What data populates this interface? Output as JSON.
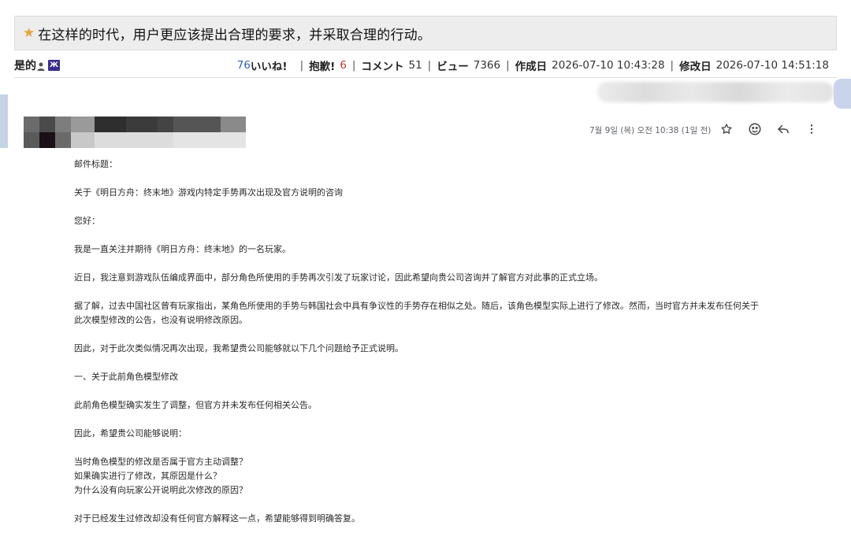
{
  "post": {
    "title": "在这样的时代，用户更应该提出合理的要求，并采取合理的行动。",
    "author": "是的",
    "badge_text": "Ж",
    "stats": {
      "likes_count": "76",
      "likes_label": "いいね!",
      "oppose_label": "抱歉!",
      "oppose_count": "6",
      "comments_label": "コメント",
      "comments_count": "51",
      "views_label": "ビュー",
      "views_count": "7366",
      "created_label": "作成日",
      "created_at": "2026-07-10 10:43:28",
      "modified_label": "修改日",
      "modified_at": "2026-07-10 14:51:18",
      "separator": "|"
    },
    "colors": {
      "accent_star": "#e8a33d",
      "likes_blue": "#2b5fb8",
      "oppose_red": "#c0392b"
    }
  },
  "email": {
    "timestamp": "7월 9일 (목) 오전 10:38 (1일 전)",
    "actions": [
      {
        "name": "star-icon"
      },
      {
        "name": "emoji-react-icon"
      },
      {
        "name": "reply-icon"
      },
      {
        "name": "more-options-icon"
      }
    ],
    "body": {
      "subject_label": "邮件标题：",
      "subject": "关于《明日方舟：终末地》游戏内特定手势再次出现及官方说明的咨询",
      "greeting": "您好：",
      "p1": "我是一直关注并期待《明日方舟：终末地》的一名玩家。",
      "p2": "近日，我注意到游戏队伍编成界面中，部分角色所使用的手势再次引发了玩家讨论，因此希望向贵公司咨询并了解官方对此事的正式立场。",
      "p3_line1": "据了解，过去中国社区曾有玩家指出，某角色所使用的手势与韩国社会中具有争议性的手势存在相似之处。随后，该角色模型实际上进行了修改。然而，当时官方并未发布任何关于",
      "p3_line2": "此次模型修改的公告，也没有说明修改原因。",
      "p4": "因此，对于此次类似情况再次出现，我希望贵公司能够就以下几个问题给予正式说明。",
      "section1": "一、关于此前角色模型修改",
      "p5": "此前角色模型确实发生了调整，但官方并未发布任何相关公告。",
      "p6": "因此，希望贵公司能够说明：",
      "q1": "当时角色模型的修改是否属于官方主动调整？",
      "q2": "如果确实进行了修改，其原因是什么？",
      "q3": "为什么没有向玩家公开说明此次修改的原因？",
      "p7": "对于已经发生过修改却没有任何官方解释这一点，希望能够得到明确答复。"
    }
  }
}
